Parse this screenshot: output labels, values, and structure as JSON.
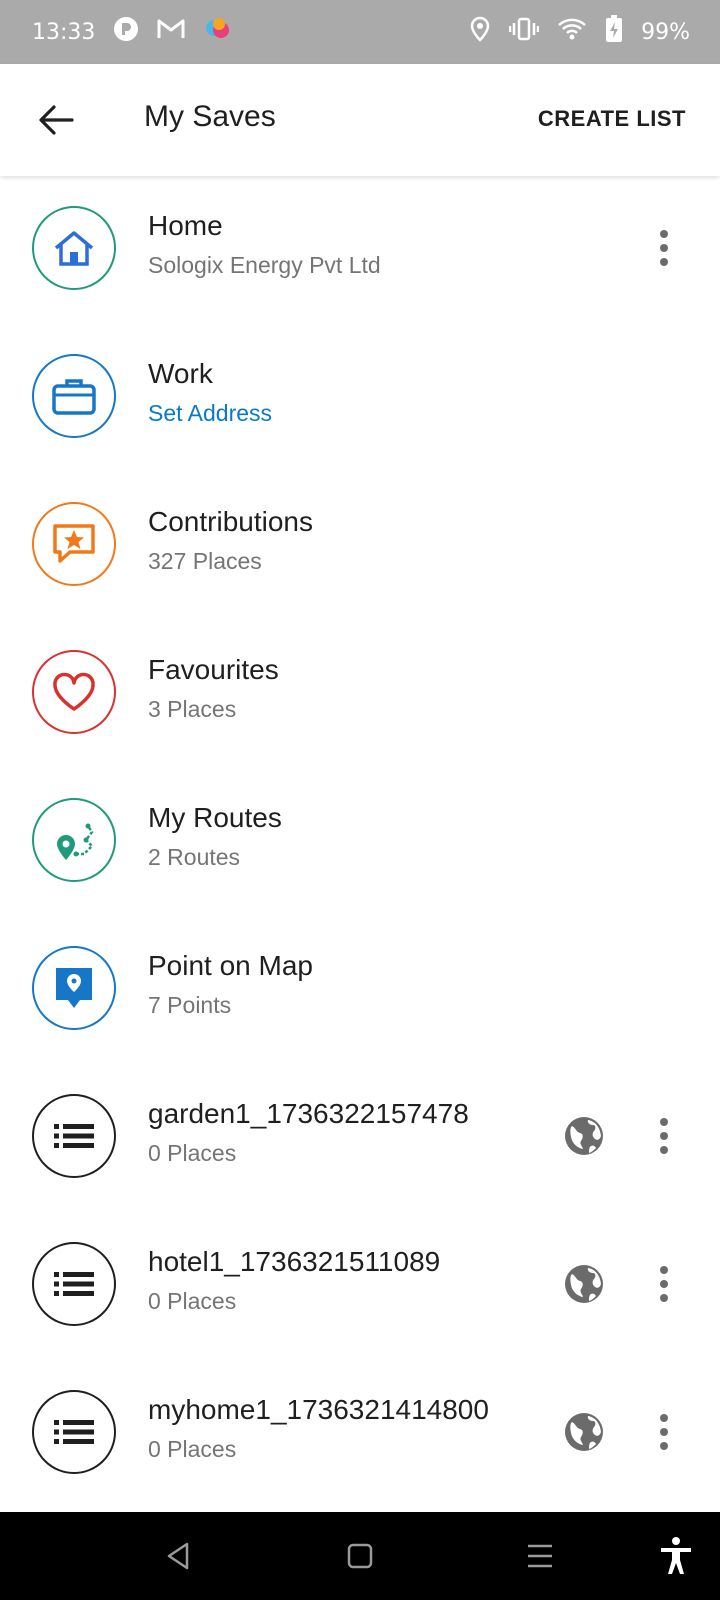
{
  "status_bar": {
    "time": "13:33",
    "battery": "99%",
    "icons": [
      "app-icon",
      "gmail-icon",
      "assistant-icon",
      "location-icon",
      "vibrate-icon",
      "wifi-icon",
      "battery-charging-icon"
    ]
  },
  "app_bar": {
    "title": "My Saves",
    "create_list_label": "CREATE LIST",
    "back_icon": "back-arrow-icon"
  },
  "items": [
    {
      "title": "Home",
      "subtitle": "Sologix Energy Pvt Ltd",
      "icon": "home-icon",
      "color": "#1f9a7a"
    },
    {
      "title": "Work",
      "subtitle": "Set Address",
      "icon": "briefcase-icon",
      "color": "#1677c9"
    },
    {
      "title": "Contributions",
      "subtitle": "327 Places",
      "icon": "star-chat-icon",
      "color": "#f07a1a"
    },
    {
      "title": "Favourites",
      "subtitle": "3 Places",
      "icon": "heart-icon",
      "color": "#d9312e"
    },
    {
      "title": "My Routes",
      "subtitle": "2 Routes",
      "icon": "route-icon",
      "color": "#1f9a7a"
    },
    {
      "title": "Point on Map",
      "subtitle": "7 Points",
      "icon": "map-pin-icon",
      "color": "#1677c9"
    },
    {
      "title": "garden1_1736322157478",
      "subtitle": "0 Places",
      "icon": "list-icon",
      "color": "#1f1f1f"
    },
    {
      "title": "hotel1_1736321511089",
      "subtitle": "0 Places",
      "icon": "list-icon",
      "color": "#1f1f1f"
    },
    {
      "title": "myhome1_1736321414800",
      "subtitle": "0 Places",
      "icon": "list-icon",
      "color": "#1f1f1f"
    }
  ],
  "nav_bar": {
    "icons": [
      "back-nav-icon",
      "home-nav-icon",
      "recents-nav-icon",
      "accessibility-icon"
    ]
  },
  "colors": {
    "link": "#0a7ac8",
    "secondary_text": "#757575",
    "status_bar_bg": "#aaaaaa"
  }
}
